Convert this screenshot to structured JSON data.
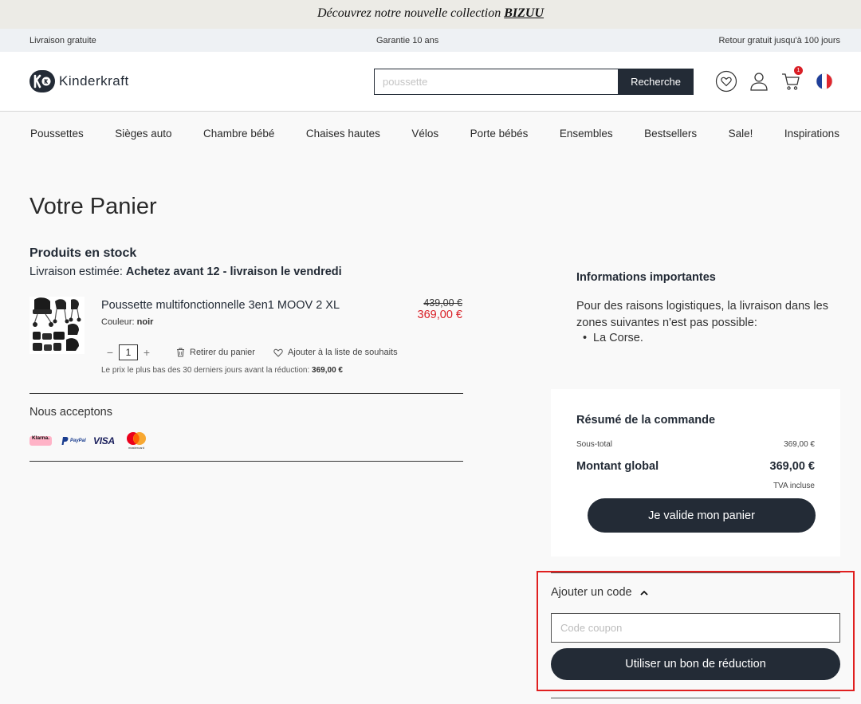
{
  "promo": {
    "text": "Découvrez notre nouvelle collection ",
    "link": "BIZUU"
  },
  "infobar": {
    "left": "Livraison gratuite",
    "center": "Garantie 10 ans",
    "right": "Retour gratuit jusqu'à 100 jours"
  },
  "header": {
    "logo_text": "Kinderkraft",
    "logo_mark": "k k",
    "search_placeholder": "poussette",
    "search_button": "Recherche",
    "cart_count": "1",
    "icons": [
      "heart-icon",
      "user-icon",
      "cart-icon",
      "flag-fr-icon"
    ]
  },
  "nav": [
    "Poussettes",
    "Sièges auto",
    "Chambre bébé",
    "Chaises hautes",
    "Vélos",
    "Porte bébés",
    "Ensembles",
    "Bestsellers",
    "Sale!",
    "Inspirations"
  ],
  "cart": {
    "title": "Votre Panier",
    "stock_heading": "Produits en stock",
    "estimate_label": "Livraison estimée: ",
    "estimate_value": "Achetez avant 12 - livraison le vendredi",
    "product": {
      "name": "Poussette multifonctionnelle 3en1 MOOV 2 XL",
      "color_label": "Couleur: ",
      "color_value": "noir",
      "old_price": "439,00 €",
      "new_price": "369,00 €",
      "qty": "1",
      "qty_minus": "−",
      "qty_plus": "+",
      "remove": "Retirer du panier",
      "wishlist": "Ajouter à la liste de souhaits",
      "lowest_label": "Le prix le plus bas des 30 derniers jours avant la réduction: ",
      "lowest_value": "369,00 €"
    },
    "accept_label": "Nous acceptons",
    "payments": {
      "klarna": "Klarna.",
      "paypal": "PayPal",
      "visa": "VISA",
      "mastercard": "mastercard"
    }
  },
  "info": {
    "heading": "Informations importantes",
    "text": "Pour des raisons logistiques, la livraison dans les zones suivantes n'est pas possible:",
    "items": [
      "La Corse."
    ]
  },
  "summary": {
    "heading": "Résumé de la commande",
    "subtotal_label": "Sous-total",
    "subtotal_value": "369,00 €",
    "total_label": "Montant global",
    "total_value": "369,00 €",
    "vat": "TVA incluse",
    "validate_button": "Je valide mon panier"
  },
  "coupon": {
    "heading": "Ajouter un code",
    "placeholder": "Code coupon",
    "button": "Utiliser un bon de réduction"
  },
  "colors": {
    "brand": "#232b36",
    "price_red": "#d91f26",
    "highlight": "#e02020"
  }
}
